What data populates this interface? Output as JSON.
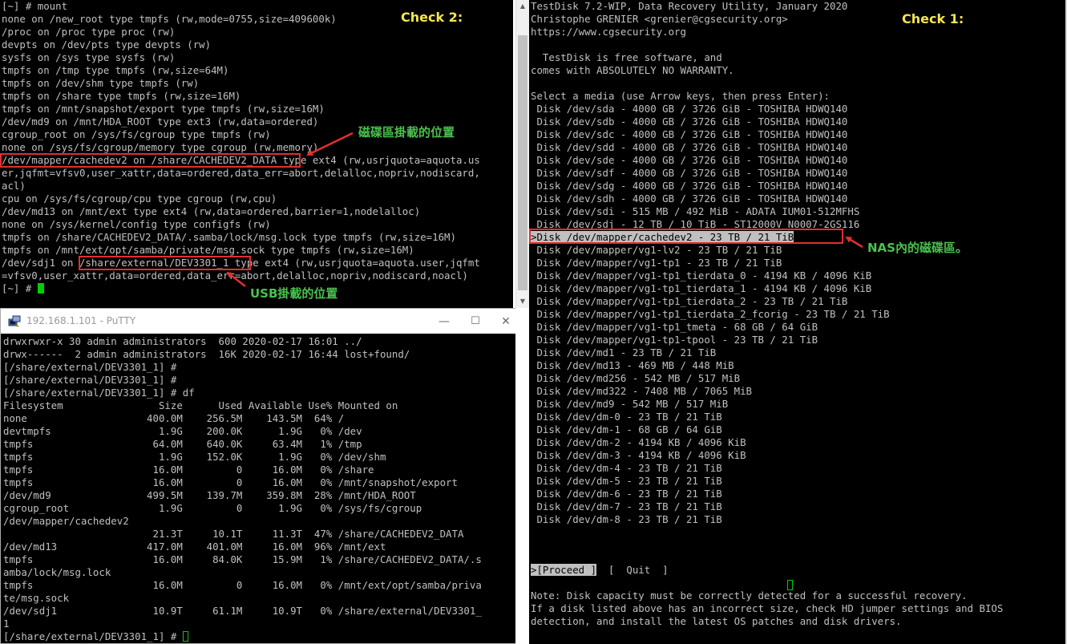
{
  "mount_terminal": {
    "lines": [
      "[~] # mount",
      "none on /new_root type tmpfs (rw,mode=0755,size=409600k)",
      "/proc on /proc type proc (rw)",
      "devpts on /dev/pts type devpts (rw)",
      "sysfs on /sys type sysfs (rw)",
      "tmpfs on /tmp type tmpfs (rw,size=64M)",
      "tmpfs on /dev/shm type tmpfs (rw)",
      "tmpfs on /share type tmpfs (rw,size=16M)",
      "tmpfs on /mnt/snapshot/export type tmpfs (rw,size=16M)",
      "/dev/md9 on /mnt/HDA_ROOT type ext3 (rw,data=ordered)",
      "cgroup_root on /sys/fs/cgroup type tmpfs (rw)",
      "none on /sys/fs/cgroup/memory type cgroup (rw,memory)",
      "/dev/mapper/cachedev2 on /share/CACHEDEV2_DATA type ext4 (rw,usrjquota=aquota.us",
      "er,jqfmt=vfsv0,user_xattr,data=ordered,data_err=abort,delalloc,nopriv,nodiscard,",
      "acl)",
      "cpu on /sys/fs/cgroup/cpu type cgroup (rw,cpu)",
      "/dev/md13 on /mnt/ext type ext4 (rw,data=ordered,barrier=1,nodelalloc)",
      "none on /sys/kernel/config type configfs (rw)",
      "tmpfs on /share/CACHEDEV2_DATA/.samba/lock/msg.lock type tmpfs (rw,size=16M)",
      "tmpfs on /mnt/ext/opt/samba/private/msg.sock type tmpfs (rw,size=16M)",
      "/dev/sdj1 on /share/external/DEV3301_1 type ext4 (rw,usrjquota=aquota.user,jqfmt",
      "=vfsv0,user_xattr,data=ordered,data_err=abort,delalloc,nopriv,nodiscard,noacl)",
      "[~] # "
    ]
  },
  "putty": {
    "title": "192.168.1.101 - PuTTY",
    "minimize": "—",
    "maximize": "☐",
    "close": "✕",
    "lines": [
      "drwxrwxr-x 30 admin administrators  600 2020-02-17 16:01 ../",
      "drwx------  2 admin administrators  16K 2020-02-17 16:44 lost+found/",
      "[/share/external/DEV3301_1] #",
      "[/share/external/DEV3301_1] #",
      "[/share/external/DEV3301_1] # df",
      "Filesystem                Size      Used Available Use% Mounted on",
      "none                    400.0M    256.5M    143.5M  64% /",
      "devtmpfs                  1.9G    200.0K      1.9G   0% /dev",
      "tmpfs                    64.0M    640.0K     63.4M   1% /tmp",
      "tmpfs                     1.9G    152.0K      1.9G   0% /dev/shm",
      "tmpfs                    16.0M         0     16.0M   0% /share",
      "tmpfs                    16.0M         0     16.0M   0% /mnt/snapshot/export",
      "/dev/md9                499.5M    139.7M    359.8M  28% /mnt/HDA_ROOT",
      "cgroup_root               1.9G         0      1.9G   0% /sys/fs/cgroup",
      "/dev/mapper/cachedev2",
      "                         21.3T     10.1T     11.3T  47% /share/CACHEDEV2_DATA",
      "/dev/md13               417.0M    401.0M     16.0M  96% /mnt/ext",
      "tmpfs                    16.0M     84.0K     15.9M   1% /share/CACHEDEV2_DATA/.s",
      "amba/lock/msg.lock",
      "tmpfs                    16.0M         0     16.0M   0% /mnt/ext/opt/samba/priva",
      "te/msg.sock",
      "/dev/sdj1                10.9T     61.1M     10.9T   0% /share/external/DEV3301_",
      "1",
      "[/share/external/DEV3301_1] # "
    ]
  },
  "testdisk": {
    "header_lines": [
      "TestDisk 7.2-WIP, Data Recovery Utility, January 2020",
      "Christophe GRENIER <grenier@cgsecurity.org>",
      "https://www.cgsecurity.org",
      "",
      "  TestDisk is free software, and",
      "comes with ABSOLUTELY NO WARRANTY.",
      "",
      "Select a media (use Arrow keys, then press Enter):"
    ],
    "disks": [
      " Disk /dev/sda - 4000 GB / 3726 GiB - TOSHIBA HDWQ140",
      " Disk /dev/sdb - 4000 GB / 3726 GiB - TOSHIBA HDWQ140",
      " Disk /dev/sdc - 4000 GB / 3726 GiB - TOSHIBA HDWQ140",
      " Disk /dev/sdd - 4000 GB / 3726 GiB - TOSHIBA HDWQ140",
      " Disk /dev/sde - 4000 GB / 3726 GiB - TOSHIBA HDWQ140",
      " Disk /dev/sdf - 4000 GB / 3726 GiB - TOSHIBA HDWQ140",
      " Disk /dev/sdg - 4000 GB / 3726 GiB - TOSHIBA HDWQ140",
      " Disk /dev/sdh - 4000 GB / 3726 GiB - TOSHIBA HDWQ140",
      " Disk /dev/sdi - 515 MB / 492 MiB - ADATA IUM01-512MFHS",
      " Disk /dev/sdj - 12 TB / 10 TiB - ST12000V N0007-2GS116",
      ">Disk /dev/mapper/cachedev2 - 23 TB / 21 TiB",
      " Disk /dev/mapper/vg1-lv2 - 23 TB / 21 TiB",
      " Disk /dev/mapper/vg1-tp1 - 23 TB / 21 TiB",
      " Disk /dev/mapper/vg1-tp1_tierdata_0 - 4194 KB / 4096 KiB",
      " Disk /dev/mapper/vg1-tp1_tierdata_1 - 4194 KB / 4096 KiB",
      " Disk /dev/mapper/vg1-tp1_tierdata_2 - 23 TB / 21 TiB",
      " Disk /dev/mapper/vg1-tp1_tierdata_2_fcorig - 23 TB / 21 TiB",
      " Disk /dev/mapper/vg1-tp1_tmeta - 68 GB / 64 GiB",
      " Disk /dev/mapper/vg1-tp1-tpool - 23 TB / 21 TiB",
      " Disk /dev/md1 - 23 TB / 21 TiB",
      " Disk /dev/md13 - 469 MB / 448 MiB",
      " Disk /dev/md256 - 542 MB / 517 MiB",
      " Disk /dev/md322 - 7408 MB / 7065 MiB",
      " Disk /dev/md9 - 542 MB / 517 MiB",
      " Disk /dev/dm-0 - 23 TB / 21 TiB",
      " Disk /dev/dm-1 - 68 GB / 64 GiB",
      " Disk /dev/dm-2 - 4194 KB / 4096 KiB",
      " Disk /dev/dm-3 - 4194 KB / 4096 KiB",
      " Disk /dev/dm-4 - 23 TB / 21 TiB",
      " Disk /dev/dm-5 - 23 TB / 21 TiB",
      " Disk /dev/dm-6 - 23 TB / 21 TiB",
      " Disk /dev/dm-7 - 23 TB / 21 TiB",
      " Disk /dev/dm-8 - 23 TB / 21 TiB"
    ],
    "selected_index": 10,
    "proceed_label": ">[Proceed ]",
    "quit_label": "[  Quit  ]",
    "note_lines": [
      "Note: Disk capacity must be correctly detected for a successful recovery.",
      "If a disk listed above has an incorrect size, check HD jumper settings and BIOS",
      "detection, and install the latest OS patches and disk drivers."
    ]
  },
  "annotations": {
    "check2": "Check 2:",
    "check1": "Check 1:",
    "disk_mount_location": "磁碟區掛載的位置",
    "usb_mount_location": "USB掛載的位置",
    "nas_volume": "NAS內的磁碟區。"
  },
  "colors": {
    "terminal_bg": "#000000",
    "terminal_text": "#c0c0c0",
    "annotation_yellow": "#f7e64a",
    "annotation_green": "#49c24d",
    "highlight_red": "#e03030",
    "cursor_green": "#00d000"
  }
}
